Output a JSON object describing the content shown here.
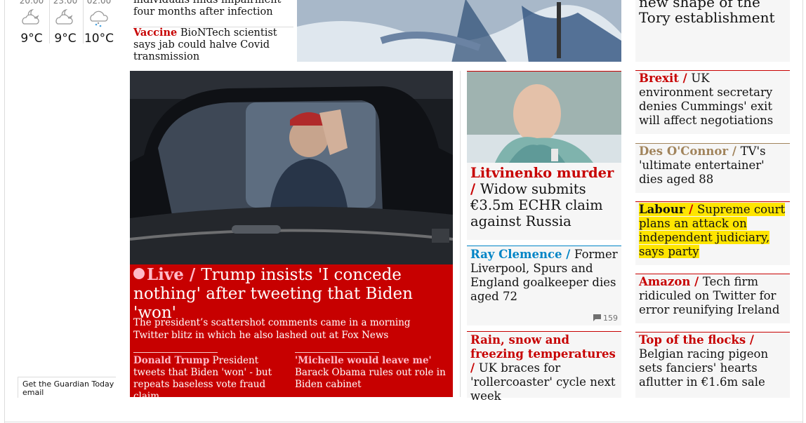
{
  "weather": {
    "forecast": [
      {
        "time": "20:00",
        "temp": "9°C",
        "icon": "partly-cloudy-night-icon"
      },
      {
        "time": "23:00",
        "temp": "9°C",
        "icon": "partly-cloudy-night-icon"
      },
      {
        "time": "02:00",
        "temp": "10°C",
        "icon": "sleet-icon"
      }
    ]
  },
  "newsletter": {
    "label": "Get the Guardian Today email"
  },
  "top_strip": {
    "story1": {
      "text": "individuals finds impairment four months after infection"
    },
    "story2": {
      "kicker": "Vaccine",
      "text": " BioNTech scientist says jab could halve Covid transmission"
    },
    "right_headline": "new shape of the Tory establishment"
  },
  "main": {
    "live": "Live",
    "sep": " / ",
    "headline": "Trump insists 'I concede nothing' after tweeting that Biden 'won'",
    "standfirst": "The president’s scattershot comments came in a morning Twitter blitz in which he also lashed out at Fox News",
    "sub1": {
      "kicker": "Donald Trump",
      "text": " President tweets that Biden 'won' - but repeats baseless vote fraud claim"
    },
    "sub2": {
      "kicker": "'Michelle would leave me'",
      "text": " Barack Obama rules out role in Biden cabinet"
    }
  },
  "middle": {
    "card1": {
      "kicker": "Litvinenko murder",
      "sep": " / ",
      "text": "Widow submits €3.5m ECHR claim against Russia"
    },
    "card2": {
      "kicker": "Ray Clemence",
      "sep": " / ",
      "text": "Former Liverpool, Spurs and England goalkeeper dies aged 72",
      "comments": "159"
    },
    "card3": {
      "kicker": "Rain, snow and freezing temperatures",
      "sep": " / ",
      "text": "UK braces for 'rollercoaster' cycle next week"
    }
  },
  "right": {
    "brexit": {
      "kicker": "Brexit",
      "sep": " / ",
      "text": "UK environment secretary denies Cummings' exit will affect negotiations"
    },
    "des": {
      "kicker": "Des O'Connor",
      "sep": " / ",
      "text": "TV's 'ultimate entertainer' dies aged 88"
    },
    "labour": {
      "kicker": "Labour",
      "sep": " / ",
      "text": "Supreme court plans an attack on independent judiciary, says party"
    },
    "amazon": {
      "kicker": "Amazon",
      "sep": " / ",
      "text": "Tech firm ridiculed on Twitter for error reunifying Ireland"
    },
    "pigeon": {
      "kicker": "Top of the flocks",
      "sep": " / ",
      "text": "Belgian racing pigeon sets fanciers' hearts aflutter in €1.6m sale"
    }
  },
  "colors": {
    "news_red": "#c70000",
    "sport_blue": "#0084c6",
    "culture_brown": "#a1845c",
    "highlight": "#ffe500"
  }
}
